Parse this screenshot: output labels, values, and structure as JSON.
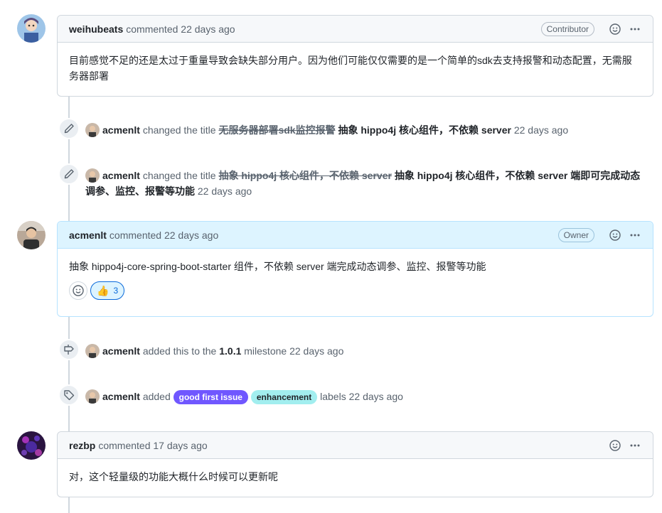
{
  "comments": [
    {
      "author": "weihubeats",
      "action": "commented 22 days ago",
      "role": "Contributor",
      "body": "目前感觉不足的还是太过于重量导致会缺失部分用户。因为他们可能仅仅需要的是一个简单的sdk去支持报警和动态配置，无需服务器部署"
    },
    {
      "author": "acmenlt",
      "action": "commented 22 days ago",
      "role": "Owner",
      "body": "抽象 hippo4j-core-spring-boot-starter 组件，不依赖 server 端完成动态调参、监控、报警等功能",
      "reaction": {
        "emoji": "👍",
        "count": "3"
      }
    },
    {
      "author": "rezbp",
      "action": "commented 17 days ago",
      "role": "",
      "body": "对，这个轻量级的功能大概什么时候可以更新呢"
    }
  ],
  "events": {
    "rename1": {
      "actor": "acmenlt",
      "verb": "changed the title",
      "old_title": "无服务器部署sdk监控报警",
      "new_title": "抽象 hippo4j 核心组件，不依赖 server",
      "time": "22 days ago"
    },
    "rename2": {
      "actor": "acmenlt",
      "verb": "changed the title",
      "old_title": "抽象 hippo4j 核心组件，不依赖 server",
      "new_title": "抽象 hippo4j 核心组件，不依赖 server 端即可完成动态调参、监控、报警等功能",
      "time": "22 days ago"
    },
    "milestone": {
      "actor": "acmenlt",
      "verb": "added this to the",
      "milestone": "1.0.1",
      "suffix": "milestone",
      "time": "22 days ago"
    },
    "labels": {
      "actor": "acmenlt",
      "verb": "added",
      "label1": "good first issue",
      "label1_color": "#7057ff",
      "label2": "enhancement",
      "label2_color": "#a2eeef",
      "suffix": "labels",
      "time": "22 days ago"
    }
  },
  "icons": {
    "rename": "pencil-icon",
    "milestone": "milestone-icon",
    "labels": "tag-icon",
    "reaction": "smiley-icon",
    "menu": "kebab-horizontal-icon"
  },
  "colors": {
    "owner_header_bg": "#ddf4ff",
    "owner_border": "#b6e3ff",
    "link_blue": "#0969da"
  }
}
